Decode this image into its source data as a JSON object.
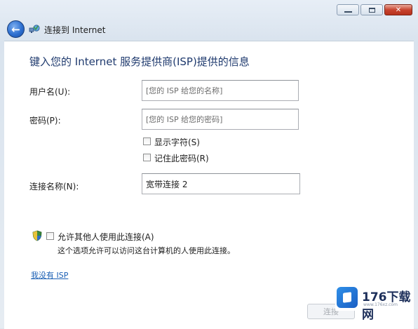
{
  "window": {
    "title": "连接到 Internet",
    "caption_buttons": {
      "minimize_icon": "minimize-icon",
      "maximize_icon": "maximize-icon",
      "close_glyph": "✕"
    }
  },
  "form": {
    "heading": "键入您的 Internet 服务提供商(ISP)提供的信息",
    "username_label": "用户名(U):",
    "username_placeholder": "[您的 ISP 给您的名称]",
    "password_label": "密码(P):",
    "password_placeholder": "[您的 ISP 给您的密码]",
    "show_chars_label": "显示字符(S)",
    "show_chars_checked": false,
    "remember_label": "记住此密码(R)",
    "remember_checked": false,
    "connection_name_label": "连接名称(N):",
    "connection_name_value": "宽带连接 2",
    "allow_others_label": "允许其他人使用此连接(A)",
    "allow_others_checked": false,
    "allow_others_desc": "这个选项允许可以访问这台计算机的人使用此连接。",
    "no_isp_link": "我没有 ISP",
    "next_button": "连接"
  },
  "watermark": {
    "brand": "176下载网",
    "url": "www.176xz.com"
  },
  "colors": {
    "heading": "#1f3a6e",
    "link": "#1a5fb4",
    "close_button": "#c8442f",
    "back_button": "#2d6fd0"
  }
}
